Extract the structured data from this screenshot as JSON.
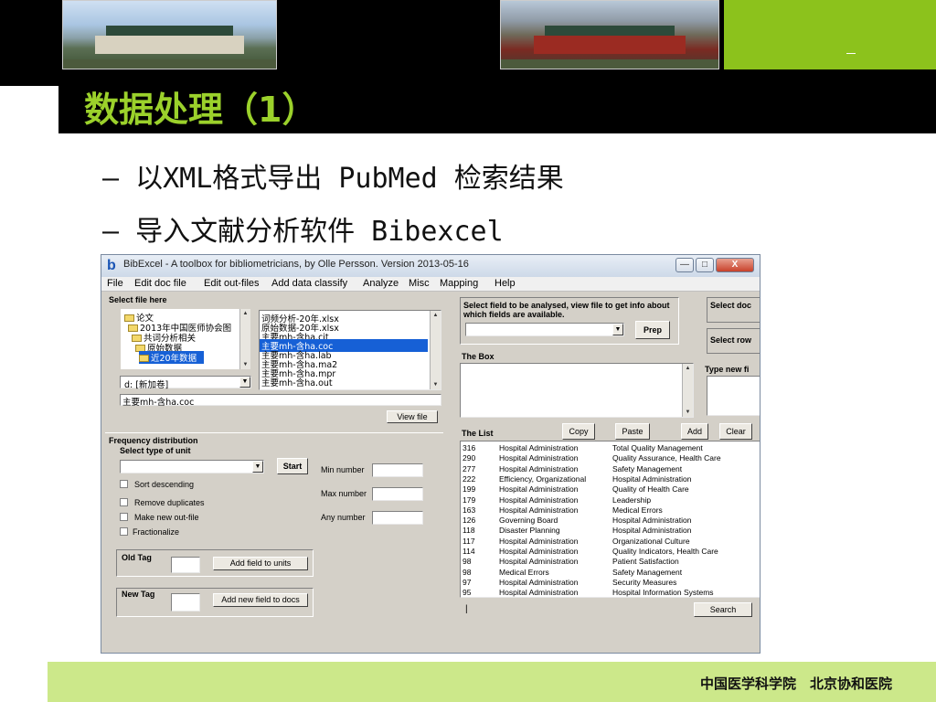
{
  "slide": {
    "title": "数据处理（1）",
    "bullets": [
      "— 以XML格式导出 PubMed 检索结果",
      "— 导入文献分析软件 Bibexcel"
    ],
    "footer": "中国医学科学院　北京协和医院",
    "colors": {
      "accent_green": "#9bd12b",
      "footer_green": "#cce88a",
      "header_black": "#000000"
    }
  },
  "window": {
    "title": "BibExcel - A toolbox for bibliometricians, by Olle Persson. Version 2013-05-16",
    "controls": {
      "minimize": "—",
      "maximize": "□",
      "close": "X"
    },
    "menu": [
      "File",
      "Edit doc file",
      "Edit out-files",
      "Add data classify",
      "Analyze",
      "Misc",
      "Mapping",
      "Help"
    ],
    "file_panel": {
      "label": "Select file here",
      "folders": [
        "论文",
        "2013年中国医师协会图",
        "共词分析相关",
        "原始数据",
        "近20年数据"
      ],
      "selected_folder": "近20年数据",
      "drive": "d: [新加卷]",
      "files": [
        "词频分析-20年.xlsx",
        "原始数据-20年.xlsx",
        "主要mh-含ha.cit",
        "主要mh-含ha.coc",
        "主要mh-含ha.lab",
        "主要mh-含ha.ma2",
        "主要mh-含ha.mpr",
        "主要mh-含ha.out"
      ],
      "selected_file": "主要mh-含ha.coc",
      "current_file": "主要mh-含ha.coc",
      "view_button": "View file"
    },
    "frequency": {
      "label": "Frequency distribution",
      "select_unit_label": "Select type of unit",
      "start_button": "Start",
      "checkboxes": [
        "Sort descending",
        "Remove duplicates",
        "Make new out-file",
        "Fractionalize"
      ],
      "min_label": "Min number",
      "max_label": "Max number",
      "any_label": "Any number"
    },
    "old_tag": {
      "label": "Old Tag",
      "button": "Add field to units"
    },
    "new_tag": {
      "label": "New Tag",
      "button": "Add new field to docs"
    },
    "field_panel": {
      "label": "Select field to be analysed, view file to get info about which fields are available.",
      "prep_button": "Prep"
    },
    "right_panel": {
      "select_doc": "Select doc",
      "select_row": "Select row",
      "type_new": "Type new fi"
    },
    "box": {
      "label": "The Box"
    },
    "list": {
      "label": "The List",
      "buttons": [
        "Copy",
        "Paste",
        "Add",
        "Clear"
      ],
      "rows": [
        [
          "316",
          "Hospital Administration",
          "Total Quality Management"
        ],
        [
          "290",
          "Hospital Administration",
          "Quality Assurance, Health Care"
        ],
        [
          "277",
          "Hospital Administration",
          "Safety Management"
        ],
        [
          "222",
          "Efficiency, Organizational",
          "Hospital Administration"
        ],
        [
          "199",
          "Hospital Administration",
          "Quality of Health Care"
        ],
        [
          "179",
          "Hospital Administration",
          "Leadership"
        ],
        [
          "163",
          "Hospital Administration",
          "Medical Errors"
        ],
        [
          "126",
          "Governing Board",
          "Hospital Administration"
        ],
        [
          "118",
          "Disaster Planning",
          "Hospital Administration"
        ],
        [
          "117",
          "Hospital Administration",
          "Organizational Culture"
        ],
        [
          "114",
          "Hospital Administration",
          "Quality Indicators, Health Care"
        ],
        [
          "98",
          "Hospital Administration",
          "Patient Satisfaction"
        ],
        [
          "98",
          "Medical Errors",
          "Safety Management"
        ],
        [
          "97",
          "Hospital Administration",
          "Security Measures"
        ],
        [
          "95",
          "Hospital Administration",
          "Hospital Information Systems"
        ]
      ],
      "search_button": "Search"
    }
  }
}
